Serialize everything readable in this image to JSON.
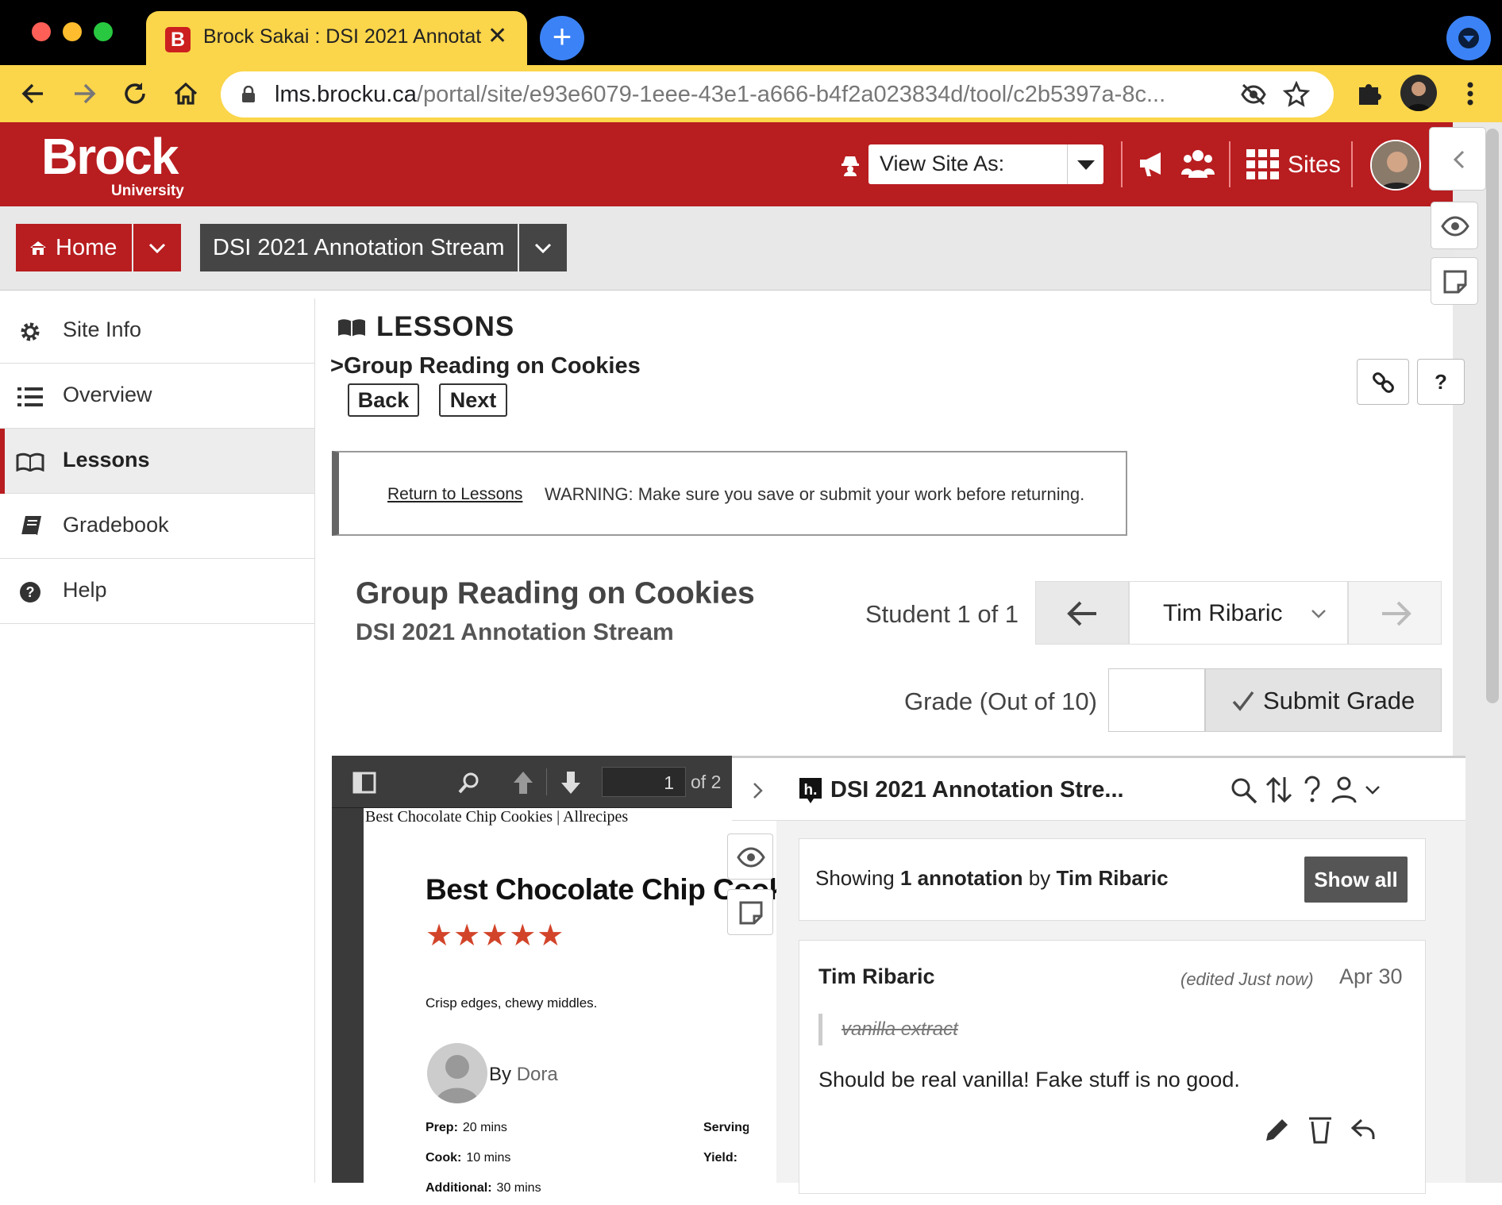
{
  "browser": {
    "tab_title": "Brock Sakai : DSI 2021 Annotat",
    "tab_favicon": "B",
    "url_host": "lms.brocku.ca",
    "url_path": "/portal/site/e93e6079-1eee-43e1-a666-b4f2a023834d/tool/c2b5397a-8c..."
  },
  "header": {
    "logo_text": "Brock",
    "logo_sub": "University",
    "view_site_as": "View Site As:",
    "sites_label": "Sites"
  },
  "nav": {
    "home_label": "Home",
    "site_label": "DSI 2021 Annotation Stream"
  },
  "sidebar": {
    "items": [
      {
        "label": "Site Info",
        "icon": "gear-icon"
      },
      {
        "label": "Overview",
        "icon": "list-icon"
      },
      {
        "label": "Lessons",
        "icon": "book-open-icon",
        "active": true
      },
      {
        "label": "Gradebook",
        "icon": "book-icon"
      },
      {
        "label": "Help",
        "icon": "help-circle-icon"
      }
    ]
  },
  "lessons": {
    "heading": "LESSONS",
    "breadcrumb": "Group Reading on Cookies",
    "back_label": "Back",
    "next_label": "Next",
    "help_label": "?"
  },
  "warning": {
    "link": "Return to Lessons",
    "text": "WARNING: Make sure you save or submit your work before returning."
  },
  "grading": {
    "title": "Group Reading on Cookies",
    "subtitle": "DSI 2021 Annotation Stream",
    "student_label": "Student 1 of 1",
    "student_name": "Tim Ribaric",
    "grade_label": "Grade (Out of 10)",
    "grade_value": "",
    "submit_label": "Submit Grade"
  },
  "pdf": {
    "page_number": "1",
    "page_total": "of 2",
    "header_text": "Best Chocolate Chip Cookies | Allrecipes",
    "title": "Best Chocolate Chip Cookies",
    "stars": "★★★★★",
    "tagline": "Crisp edges, chewy middles.",
    "by_label": "By",
    "author": "Dora",
    "prep_label": "Prep:",
    "prep_value": "20 mins",
    "cook_label": "Cook:",
    "cook_value": "10 mins",
    "additional_label": "Additional:",
    "additional_value": "30 mins",
    "servings_label": "Serving",
    "yield_label": "Yield:"
  },
  "hypothesis": {
    "group_title": "DSI 2021 Annotation Stre...",
    "filter_prefix": "Showing",
    "filter_count": "1 annotation",
    "filter_by": "by",
    "filter_user": "Tim Ribaric",
    "show_all_label": "Show all",
    "annotation": {
      "user": "Tim Ribaric",
      "edited": "(edited Just now)",
      "date": "Apr 30",
      "quote": "vanilla extract",
      "body": "Should be real vanilla! Fake stuff is no good."
    }
  },
  "colors": {
    "brand_red": "#b81d20",
    "chrome_yellow": "#fbd54a",
    "star_orange": "#d2442a"
  }
}
